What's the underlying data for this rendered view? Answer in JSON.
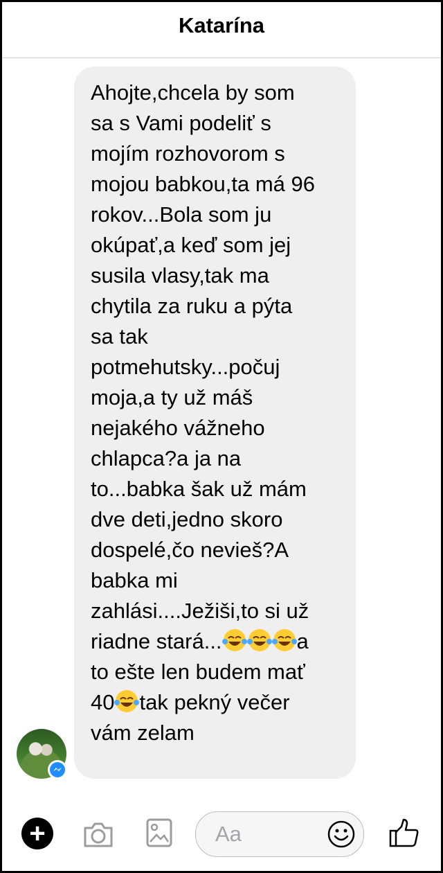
{
  "header": {
    "title": "Katarína"
  },
  "message": {
    "lines": [
      "Ahojte,chcela by som",
      "sa s Vami podeliť s",
      "mojím rozhovorom s",
      "mojou babkou,ta má 96",
      "rokov...Bola som ju",
      "okúpať,a keď som jej",
      "susila vlasy,tak ma",
      "chytila za ruku a pýta",
      "sa tak",
      "potmehutsky...počuj",
      "moja,a ty už máš",
      "nejakého vážneho",
      "chlapca?a ja na",
      "to...babka šak už mám",
      "dve deti,jedno skoro",
      "dospelé,čo nevieš?A",
      "babka mi",
      "zahlási....Ježiši,to si už"
    ],
    "line_19_text": "riadne stará...",
    "line_19_tail": "a",
    "line_20": "to ešte len budem mať",
    "line_21_num": "40",
    "line_21_tail": "tak pekný večer",
    "line_22": "vám zelam"
  },
  "composer": {
    "placeholder": "Aa"
  },
  "icons": {
    "add": "plus-icon",
    "camera": "camera-icon",
    "gallery": "image-icon",
    "emoji": "smiley-icon",
    "like": "thumbs-up-icon",
    "badge": "messenger-icon"
  },
  "colors": {
    "bubble": "#f0eff0",
    "badge": "#1f8efa",
    "accent": "#000000"
  }
}
